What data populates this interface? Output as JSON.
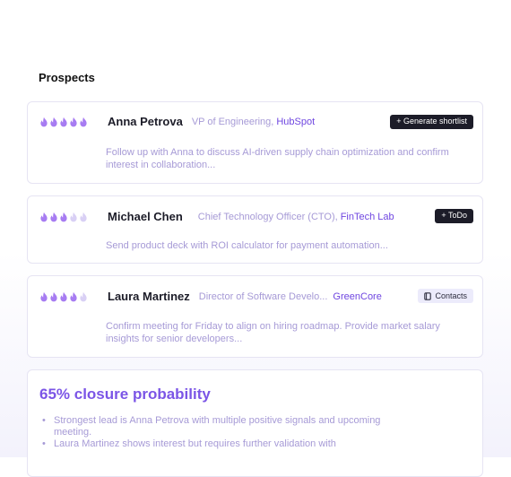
{
  "section_title": "Prospects",
  "colors": {
    "flame_active": "#a77cf2",
    "flame_inactive": "#d9d0f5",
    "accent": "#6f46e0",
    "muted_text": "#a69ad6"
  },
  "prospects": [
    {
      "name": "Anna Petrova",
      "role": "VP of Engineering,",
      "company": "HubSpot",
      "rating": 5,
      "action": "+ Generate shortlist",
      "note": "Follow up with Anna to discuss AI-driven supply chain optimization and confirm interest in collaboration..."
    },
    {
      "name": "Michael Chen",
      "role": "Chief Technology Officer (CTO),",
      "company": "FinTech Lab",
      "rating": 3,
      "action": "+ ToDo",
      "note": "Send product deck with ROI calculator for payment automation..."
    },
    {
      "name": "Laura Martinez",
      "role": "Director of Software Develo...",
      "company": "GreenCore",
      "rating": 4,
      "action": "Contacts",
      "note": "Confirm meeting for Friday to align on hiring roadmap. Provide market salary insights for senior developers..."
    }
  ],
  "summary": {
    "title": "65% closure probability",
    "bullets": [
      "Strongest lead is Anna Petrova with multiple positive signals and upcoming meeting.",
      "Laura Martinez shows interest but requires further validation with"
    ]
  }
}
